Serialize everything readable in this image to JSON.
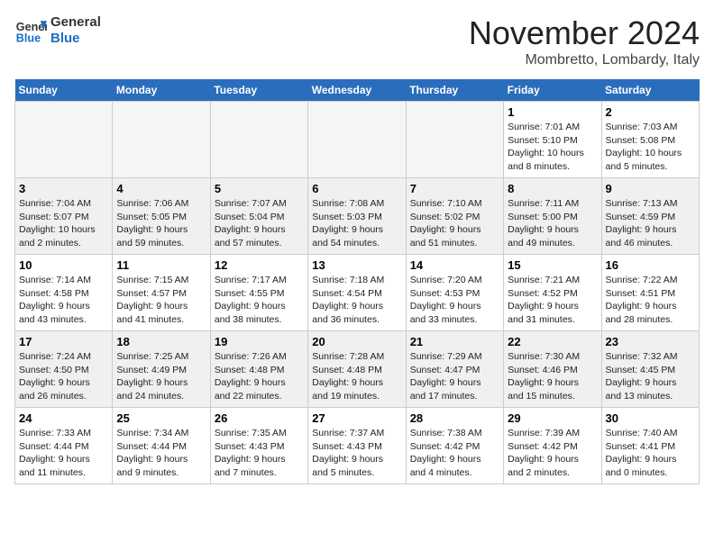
{
  "header": {
    "logo_line1": "General",
    "logo_line2": "Blue",
    "month": "November 2024",
    "location": "Mombretto, Lombardy, Italy"
  },
  "weekdays": [
    "Sunday",
    "Monday",
    "Tuesday",
    "Wednesday",
    "Thursday",
    "Friday",
    "Saturday"
  ],
  "weeks": [
    [
      {
        "day": "",
        "info": ""
      },
      {
        "day": "",
        "info": ""
      },
      {
        "day": "",
        "info": ""
      },
      {
        "day": "",
        "info": ""
      },
      {
        "day": "",
        "info": ""
      },
      {
        "day": "1",
        "info": "Sunrise: 7:01 AM\nSunset: 5:10 PM\nDaylight: 10 hours\nand 8 minutes."
      },
      {
        "day": "2",
        "info": "Sunrise: 7:03 AM\nSunset: 5:08 PM\nDaylight: 10 hours\nand 5 minutes."
      }
    ],
    [
      {
        "day": "3",
        "info": "Sunrise: 7:04 AM\nSunset: 5:07 PM\nDaylight: 10 hours\nand 2 minutes."
      },
      {
        "day": "4",
        "info": "Sunrise: 7:06 AM\nSunset: 5:05 PM\nDaylight: 9 hours\nand 59 minutes."
      },
      {
        "day": "5",
        "info": "Sunrise: 7:07 AM\nSunset: 5:04 PM\nDaylight: 9 hours\nand 57 minutes."
      },
      {
        "day": "6",
        "info": "Sunrise: 7:08 AM\nSunset: 5:03 PM\nDaylight: 9 hours\nand 54 minutes."
      },
      {
        "day": "7",
        "info": "Sunrise: 7:10 AM\nSunset: 5:02 PM\nDaylight: 9 hours\nand 51 minutes."
      },
      {
        "day": "8",
        "info": "Sunrise: 7:11 AM\nSunset: 5:00 PM\nDaylight: 9 hours\nand 49 minutes."
      },
      {
        "day": "9",
        "info": "Sunrise: 7:13 AM\nSunset: 4:59 PM\nDaylight: 9 hours\nand 46 minutes."
      }
    ],
    [
      {
        "day": "10",
        "info": "Sunrise: 7:14 AM\nSunset: 4:58 PM\nDaylight: 9 hours\nand 43 minutes."
      },
      {
        "day": "11",
        "info": "Sunrise: 7:15 AM\nSunset: 4:57 PM\nDaylight: 9 hours\nand 41 minutes."
      },
      {
        "day": "12",
        "info": "Sunrise: 7:17 AM\nSunset: 4:55 PM\nDaylight: 9 hours\nand 38 minutes."
      },
      {
        "day": "13",
        "info": "Sunrise: 7:18 AM\nSunset: 4:54 PM\nDaylight: 9 hours\nand 36 minutes."
      },
      {
        "day": "14",
        "info": "Sunrise: 7:20 AM\nSunset: 4:53 PM\nDaylight: 9 hours\nand 33 minutes."
      },
      {
        "day": "15",
        "info": "Sunrise: 7:21 AM\nSunset: 4:52 PM\nDaylight: 9 hours\nand 31 minutes."
      },
      {
        "day": "16",
        "info": "Sunrise: 7:22 AM\nSunset: 4:51 PM\nDaylight: 9 hours\nand 28 minutes."
      }
    ],
    [
      {
        "day": "17",
        "info": "Sunrise: 7:24 AM\nSunset: 4:50 PM\nDaylight: 9 hours\nand 26 minutes."
      },
      {
        "day": "18",
        "info": "Sunrise: 7:25 AM\nSunset: 4:49 PM\nDaylight: 9 hours\nand 24 minutes."
      },
      {
        "day": "19",
        "info": "Sunrise: 7:26 AM\nSunset: 4:48 PM\nDaylight: 9 hours\nand 22 minutes."
      },
      {
        "day": "20",
        "info": "Sunrise: 7:28 AM\nSunset: 4:48 PM\nDaylight: 9 hours\nand 19 minutes."
      },
      {
        "day": "21",
        "info": "Sunrise: 7:29 AM\nSunset: 4:47 PM\nDaylight: 9 hours\nand 17 minutes."
      },
      {
        "day": "22",
        "info": "Sunrise: 7:30 AM\nSunset: 4:46 PM\nDaylight: 9 hours\nand 15 minutes."
      },
      {
        "day": "23",
        "info": "Sunrise: 7:32 AM\nSunset: 4:45 PM\nDaylight: 9 hours\nand 13 minutes."
      }
    ],
    [
      {
        "day": "24",
        "info": "Sunrise: 7:33 AM\nSunset: 4:44 PM\nDaylight: 9 hours\nand 11 minutes."
      },
      {
        "day": "25",
        "info": "Sunrise: 7:34 AM\nSunset: 4:44 PM\nDaylight: 9 hours\nand 9 minutes."
      },
      {
        "day": "26",
        "info": "Sunrise: 7:35 AM\nSunset: 4:43 PM\nDaylight: 9 hours\nand 7 minutes."
      },
      {
        "day": "27",
        "info": "Sunrise: 7:37 AM\nSunset: 4:43 PM\nDaylight: 9 hours\nand 5 minutes."
      },
      {
        "day": "28",
        "info": "Sunrise: 7:38 AM\nSunset: 4:42 PM\nDaylight: 9 hours\nand 4 minutes."
      },
      {
        "day": "29",
        "info": "Sunrise: 7:39 AM\nSunset: 4:42 PM\nDaylight: 9 hours\nand 2 minutes."
      },
      {
        "day": "30",
        "info": "Sunrise: 7:40 AM\nSunset: 4:41 PM\nDaylight: 9 hours\nand 0 minutes."
      }
    ]
  ]
}
